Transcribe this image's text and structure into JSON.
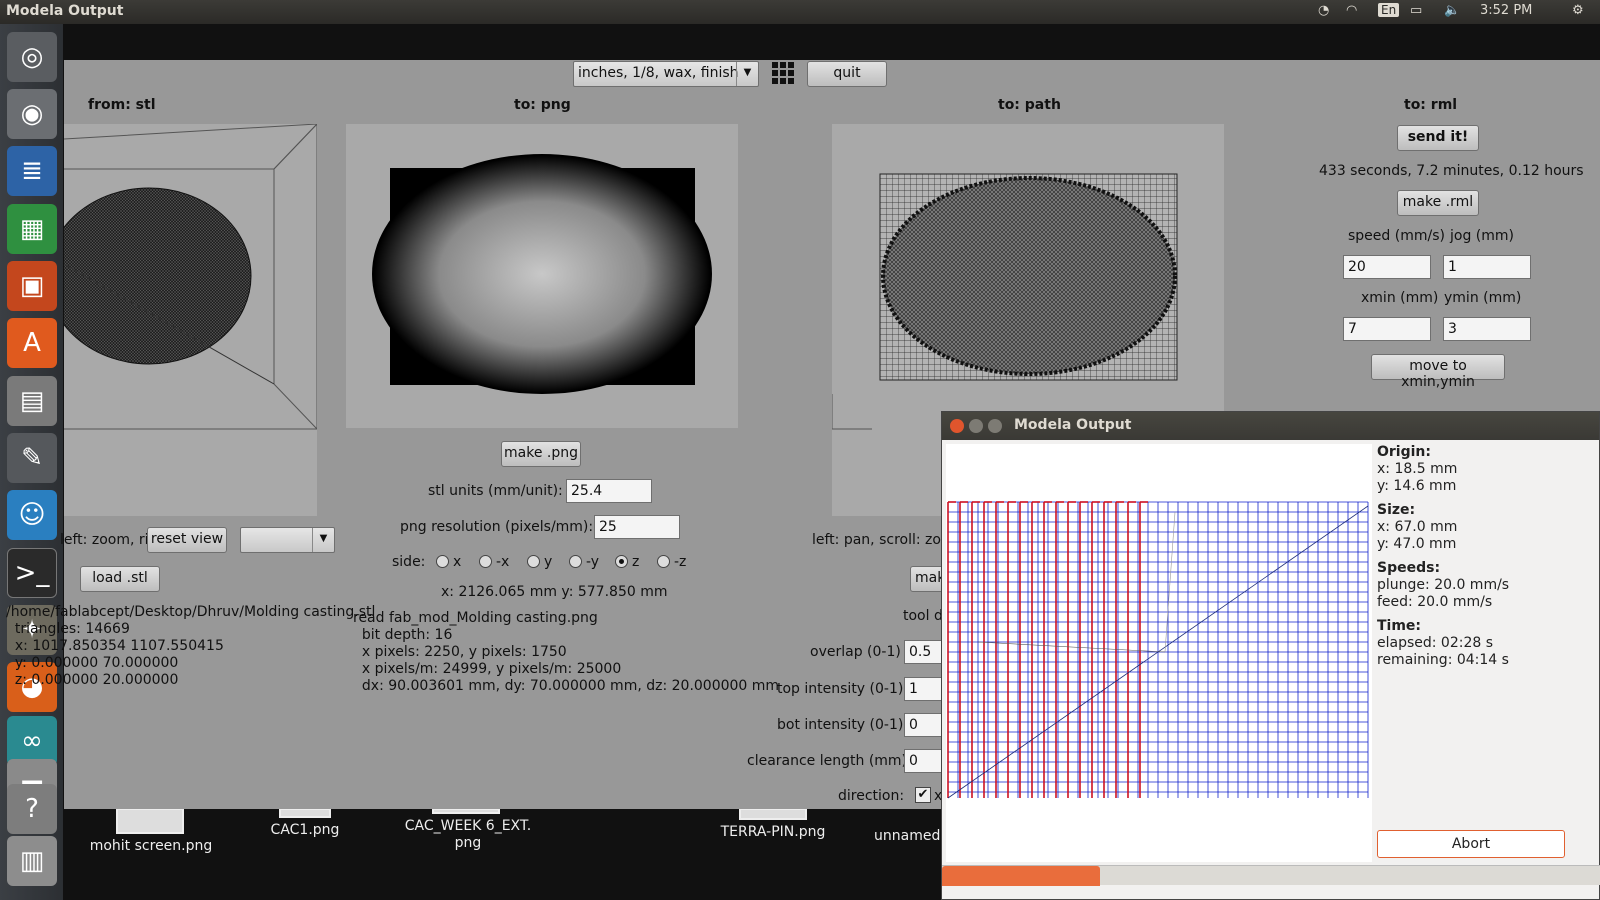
{
  "topbar": {
    "title": "Modela Output",
    "lang": "En",
    "clock": "3:52 PM"
  },
  "launcher": {
    "icons": [
      "ubuntu-dash-icon",
      "camera-icon",
      "writer-icon",
      "calc-icon",
      "impress-icon",
      "software-center-icon",
      "files-icon",
      "settings-icon",
      "chat-icon",
      "terminal-icon",
      "gimp-icon",
      "firefox-icon",
      "arduino-icon",
      "drive-icon",
      "help-icon",
      "trash-icon"
    ]
  },
  "app": {
    "preset": "inches, 1/8, wax, finish",
    "quit_label": "quit",
    "headers": {
      "stl": "from: stl",
      "png": "to: png",
      "path": "to: path",
      "rml": "to: rml"
    },
    "stl": {
      "hint": "left: zoom, right: rotate",
      "reset_view": "reset view",
      "load_label": "load .stl",
      "file_path": "/home/fablabcept/Desktop/Dhruv/Molding casting.stl",
      "info": [
        "  triangles: 14669",
        "  x: 1017.850354 1107.550415",
        "  y: 0.000000 70.000000",
        "  z: 0.000000 20.000000"
      ]
    },
    "png": {
      "make_label": "make .png",
      "stl_units_label": "stl units (mm/unit):",
      "stl_units_value": "25.4",
      "resolution_label": "png resolution (pixels/mm):",
      "resolution_value": "25",
      "side_label": "side:",
      "sides": [
        "x",
        "-x",
        "y",
        "-y",
        "z",
        "-z"
      ],
      "side_selected": "z",
      "coords": "x: 2126.065 mm  y: 577.850 mm",
      "info": [
        "read fab_mod_Molding casting.png",
        "  bit depth: 16",
        "  x pixels: 2250, y pixels: 1750",
        "  x pixels/m: 24999, y pixels/m: 25000",
        "  dx: 90.003601 mm, dy: 70.000000 mm, dz: 20.000000 mm"
      ]
    },
    "path": {
      "hint": "left: pan, scroll: zoom",
      "make_label": "make .path",
      "tool_label": "tool diameter (mm)",
      "overlap_label": "overlap (0-1)",
      "overlap_value": "0.5",
      "top_intensity_label": "top intensity (0-1)",
      "top_intensity_value": "1",
      "bot_intensity_label": "bot intensity (0-1)",
      "bot_intensity_value": "0",
      "clearance_label": "clearance length (mm)",
      "clearance_value": "0",
      "direction_label": "direction:",
      "direction_option": "x"
    },
    "rml": {
      "send_label": "send it!",
      "time_estimate": "433 seconds, 7.2 minutes, 0.12 hours",
      "make_label": "make .rml",
      "speed_label": "speed (mm/s)",
      "speed_value": "20",
      "jog_label": "jog (mm)",
      "jog_value": "1",
      "xmin_label": "xmin (mm)",
      "xmin_value": "7",
      "ymin_label": "ymin (mm)",
      "ymin_value": "3",
      "move_label": "move to xmin,ymin"
    }
  },
  "desktop": {
    "files": [
      "mohit screen.png",
      "CAC1.png",
      "CAC_WEEK 6_EXT.",
      "png",
      "TERRA-PIN.png",
      "unnamed"
    ]
  },
  "dialog": {
    "title": "Modela Output",
    "origin_label": "Origin:",
    "origin_x": "x: 18.5 mm",
    "origin_y": "y: 14.6 mm",
    "size_label": "Size:",
    "size_x": "x: 67.0 mm",
    "size_y": "y: 47.0 mm",
    "speeds_label": "Speeds:",
    "plunge": "plunge: 20.0 mm/s",
    "feed": "feed: 20.0 mm/s",
    "time_label": "Time:",
    "elapsed": "elapsed: 02:28 s",
    "remaining": "remaining: 04:14 s",
    "abort_label": "Abort",
    "progress": 0.24,
    "colors": {
      "done": "#cc1122",
      "pending": "#1122cc"
    }
  }
}
